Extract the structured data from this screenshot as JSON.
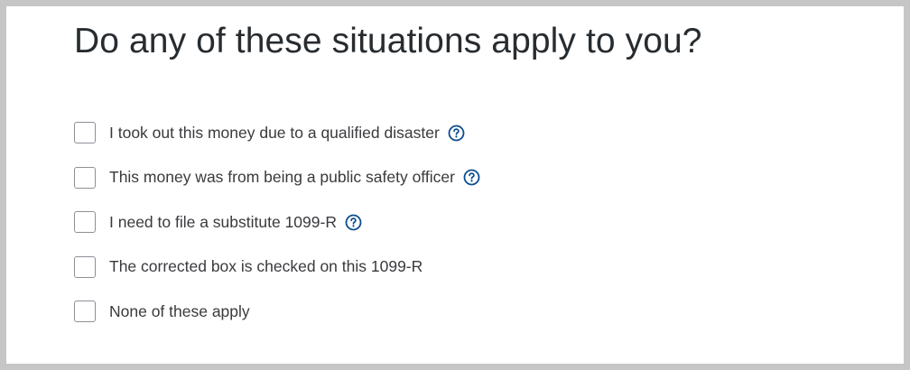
{
  "page": {
    "title": "Do any of these situations apply to you?"
  },
  "options": [
    {
      "label": "I took out this money due to a qualified disaster",
      "checked": false,
      "has_help": true
    },
    {
      "label": "This money was from being a public safety officer",
      "checked": false,
      "has_help": true
    },
    {
      "label": "I need to file a substitute 1099-R",
      "checked": false,
      "has_help": true
    },
    {
      "label": "The corrected box is checked on this 1099-R",
      "checked": false,
      "has_help": false
    },
    {
      "label": "None of these apply",
      "checked": false,
      "has_help": false
    }
  ],
  "icons": {
    "help": "question-circle-icon"
  },
  "colors": {
    "help_icon": "#0d4d8f",
    "text": "#393a3d",
    "checkbox_border": "#8d9096"
  }
}
